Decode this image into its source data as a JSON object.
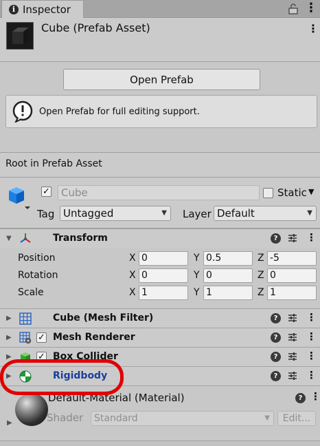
{
  "tab": {
    "title": "Inspector",
    "info_icon": "i"
  },
  "header": {
    "title": "Cube (Prefab Asset)"
  },
  "open_prefab": {
    "button_label": "Open Prefab",
    "help_text": "Open Prefab for full editing support."
  },
  "root_label": "Root in Prefab Asset",
  "gameobject": {
    "name_value": "Cube",
    "static_label": "Static",
    "tag_label": "Tag",
    "tag_value": "Untagged",
    "layer_label": "Layer",
    "layer_value": "Default"
  },
  "transform": {
    "title": "Transform",
    "rows": [
      {
        "label": "Position",
        "x": "0",
        "y": "0.5",
        "z": "-5"
      },
      {
        "label": "Rotation",
        "x": "0",
        "y": "0",
        "z": "0"
      },
      {
        "label": "Scale",
        "x": "1",
        "y": "1",
        "z": "1"
      }
    ],
    "axes": [
      "X",
      "Y",
      "Z"
    ]
  },
  "components": [
    {
      "title": "Cube (Mesh Filter)"
    },
    {
      "title": "Mesh Renderer"
    },
    {
      "title": "Box Collider"
    },
    {
      "title": "Rigidbody",
      "color": "#1a3e9c"
    }
  ],
  "material": {
    "title": "Default-Material (Material)",
    "shader_label": "Shader",
    "shader_value": "Standard",
    "edit_label": "Edit..."
  },
  "icons": {
    "help": "?",
    "more": "⋮",
    "foldout_collapsed": "▶",
    "foldout_expanded": "▼",
    "caret": "▼",
    "check": "✓"
  },
  "colors": {
    "highlight_ring": "#e00000",
    "rigidbody_label": "#1a3e9c"
  }
}
